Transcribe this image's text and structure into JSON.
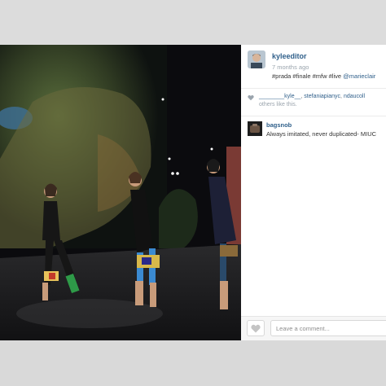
{
  "post": {
    "username": "kyleeditor",
    "timestamp": "7 months ago",
    "caption_tags": "#prada #finale #mfw #live",
    "caption_mention": "@marieclair",
    "likes": {
      "liker_1": "________kyle__",
      "liker_2": "stefaniapianyc",
      "liker_3": "ndaucoll",
      "others_text": "others like this."
    },
    "comments": [
      {
        "user": "bagsnob",
        "text": "Always imitated, never duplicated- MIUC"
      }
    ]
  },
  "footer": {
    "comment_placeholder": "Leave a comment..."
  },
  "icons": {
    "like": "heart-icon",
    "likes_indicator": "heart-icon"
  },
  "colors": {
    "link": "#2f5f8a",
    "muted": "#9aa4ad",
    "band": "#d9d9d9"
  }
}
